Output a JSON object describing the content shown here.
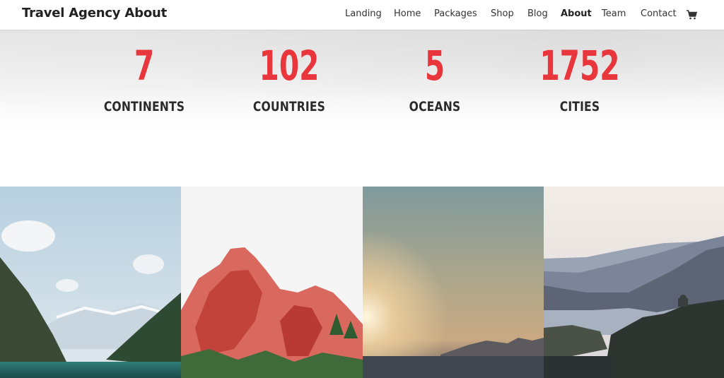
{
  "header": {
    "brand": "Travel Agency About",
    "nav": [
      {
        "label": "Landing"
      },
      {
        "label": "Home"
      },
      {
        "label": "Packages"
      },
      {
        "label": "Shop"
      },
      {
        "label": "Blog"
      },
      {
        "label": "About",
        "active": true
      },
      {
        "label": "Team"
      },
      {
        "label": "Contact"
      }
    ],
    "cart_icon": "shopping-cart-icon"
  },
  "stats": [
    {
      "number": "7",
      "label": "CONTINENTS"
    },
    {
      "number": "102",
      "label": "COUNTRIES"
    },
    {
      "number": "5",
      "label": "OCEANS"
    },
    {
      "number": "1752",
      "label": "CITIES"
    }
  ],
  "colors": {
    "accent": "#e8363c",
    "text_dark": "#2b2b2b"
  },
  "gallery": [
    {
      "subject": "mountain-lake-image"
    },
    {
      "subject": "red-rock-formation-image"
    },
    {
      "subject": "sunset-over-sea-image"
    },
    {
      "subject": "river-gorge-image"
    }
  ]
}
